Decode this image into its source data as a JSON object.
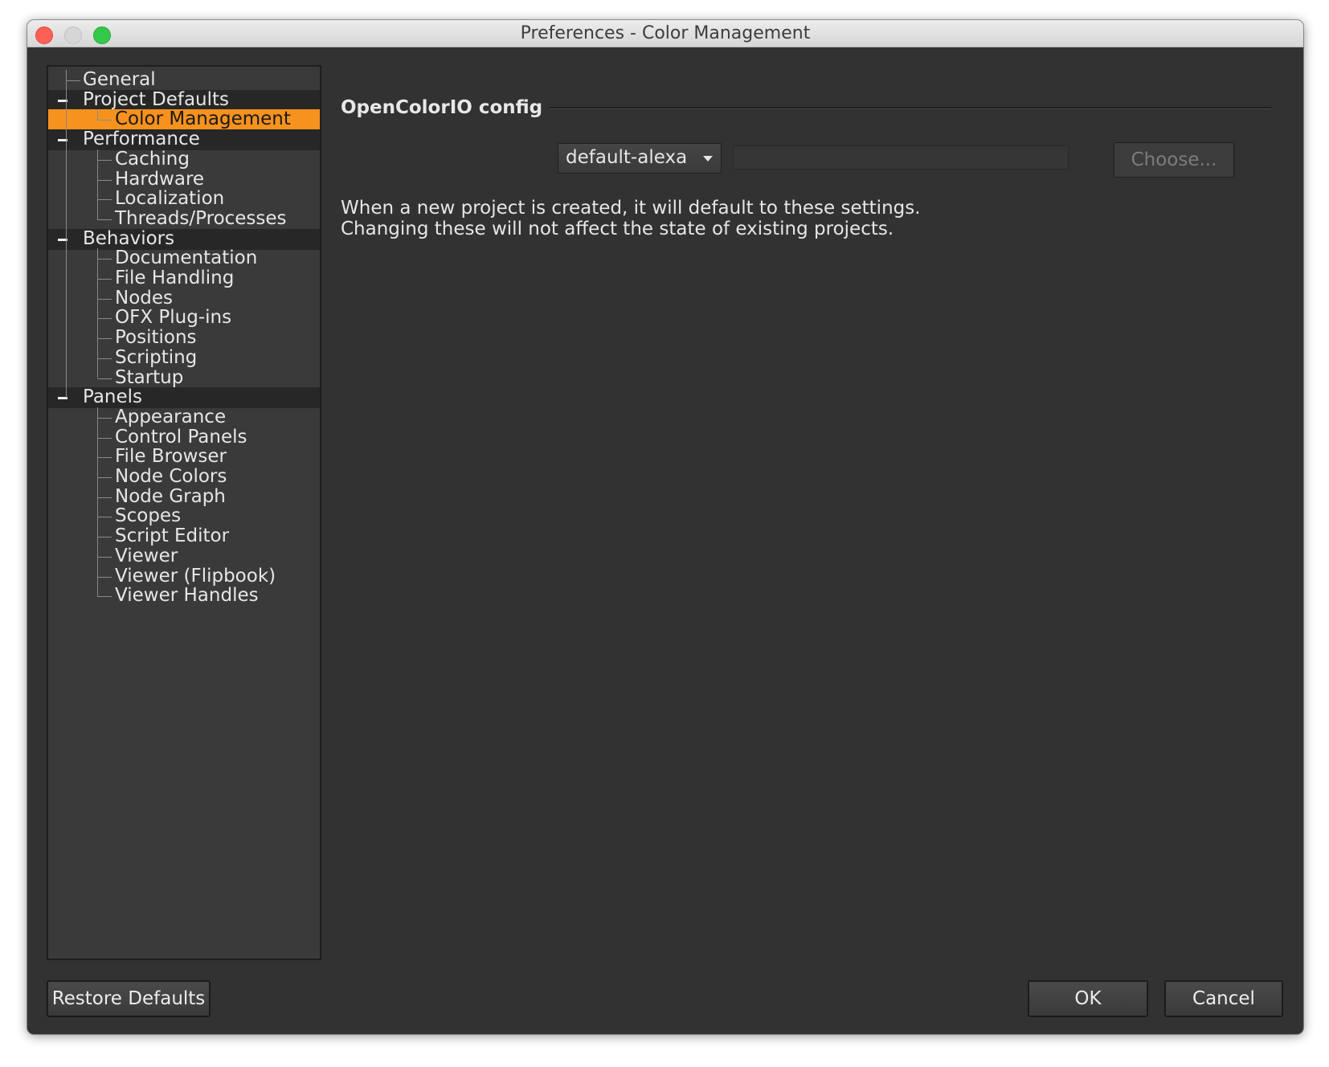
{
  "window": {
    "title": "Preferences - Color Management"
  },
  "sidebar": {
    "items": [
      {
        "label": "General",
        "level": 0,
        "group": false
      },
      {
        "label": "Project Defaults",
        "level": 0,
        "group": true
      },
      {
        "label": "Color Management",
        "level": 1,
        "group": false,
        "selected": true
      },
      {
        "label": "Performance",
        "level": 0,
        "group": true
      },
      {
        "label": "Caching",
        "level": 1,
        "group": false
      },
      {
        "label": "Hardware",
        "level": 1,
        "group": false
      },
      {
        "label": "Localization",
        "level": 1,
        "group": false
      },
      {
        "label": "Threads/Processes",
        "level": 1,
        "group": false
      },
      {
        "label": "Behaviors",
        "level": 0,
        "group": true
      },
      {
        "label": "Documentation",
        "level": 1,
        "group": false
      },
      {
        "label": "File Handling",
        "level": 1,
        "group": false
      },
      {
        "label": "Nodes",
        "level": 1,
        "group": false
      },
      {
        "label": "OFX Plug-ins",
        "level": 1,
        "group": false
      },
      {
        "label": "Positions",
        "level": 1,
        "group": false
      },
      {
        "label": "Scripting",
        "level": 1,
        "group": false
      },
      {
        "label": "Startup",
        "level": 1,
        "group": false
      },
      {
        "label": "Panels",
        "level": 0,
        "group": true
      },
      {
        "label": "Appearance",
        "level": 1,
        "group": false
      },
      {
        "label": "Control Panels",
        "level": 1,
        "group": false
      },
      {
        "label": "File Browser",
        "level": 1,
        "group": false
      },
      {
        "label": "Node Colors",
        "level": 1,
        "group": false
      },
      {
        "label": "Node Graph",
        "level": 1,
        "group": false
      },
      {
        "label": "Scopes",
        "level": 1,
        "group": false
      },
      {
        "label": "Script Editor",
        "level": 1,
        "group": false
      },
      {
        "label": "Viewer",
        "level": 1,
        "group": false
      },
      {
        "label": "Viewer (Flipbook)",
        "level": 1,
        "group": false
      },
      {
        "label": "Viewer Handles",
        "level": 1,
        "group": false
      }
    ]
  },
  "main": {
    "section_title": "OpenColorIO config",
    "config_select": "default-alexa",
    "config_path": "",
    "choose_label": "Choose...",
    "info_lines": [
      "When a new project is created, it will default to these settings.",
      "Changing these will not affect the state of existing projects."
    ]
  },
  "footer": {
    "restore_label": "Restore Defaults",
    "ok_label": "OK",
    "cancel_label": "Cancel"
  },
  "colors": {
    "selection": "#f7921e",
    "background": "#323232"
  }
}
